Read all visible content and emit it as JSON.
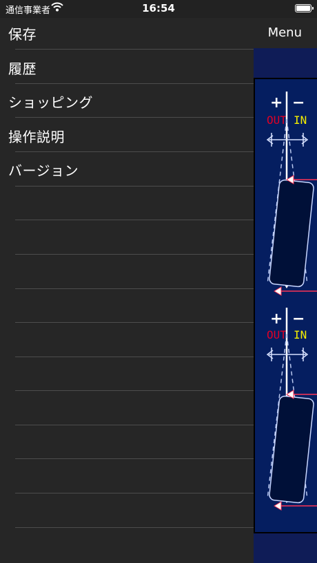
{
  "status_bar": {
    "carrier": "通信事業者",
    "time": "16:54"
  },
  "header": {
    "menu_label": "Menu"
  },
  "menu": {
    "items": [
      {
        "label": "保存"
      },
      {
        "label": "履歴"
      },
      {
        "label": "ショッピング"
      },
      {
        "label": "操作説明"
      },
      {
        "label": "バージョン"
      }
    ]
  },
  "diagram": {
    "plus": "+",
    "minus": "−",
    "out_label": "OUT",
    "in_label": "IN"
  },
  "colors": {
    "panel": "#262626",
    "diagram_bg": "#051e60",
    "out": "#e00025",
    "in": "#f5ef00",
    "arrow_red": "#ff3355"
  }
}
